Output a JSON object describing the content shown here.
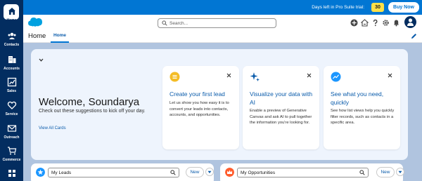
{
  "rail": {
    "items": [
      {
        "label": "Home",
        "icon": "home-icon"
      },
      {
        "label": "Contacts",
        "icon": "contacts-icon"
      },
      {
        "label": "Accounts",
        "icon": "accounts-icon"
      },
      {
        "label": "Sales",
        "icon": "sales-icon"
      },
      {
        "label": "Service",
        "icon": "service-icon"
      },
      {
        "label": "Outreach",
        "icon": "outreach-icon"
      },
      {
        "label": "Commerce",
        "icon": "commerce-icon"
      }
    ]
  },
  "banner": {
    "text": "Days left in Pro Suite trial:",
    "days": "30",
    "buy_label": "Buy Now",
    "color": "#0176d3"
  },
  "header": {
    "search_placeholder": "Search..."
  },
  "appnav": {
    "app_name": "Home",
    "tab_home": "Home"
  },
  "welcome": {
    "title": "Welcome, Soundarya",
    "subtitle": "Check out these suggestions to kick off your day.",
    "view_all": "View All Cards"
  },
  "cards": [
    {
      "title": "Create your first lead",
      "body": "Let us show you how easy it is to convert your leads into contacts, accounts, and opportunities.",
      "icon": "lead-icon",
      "icon_color": "#f4bc25"
    },
    {
      "title": "Visualize your data with AI",
      "body": "Enable a preview of Generative Canvas and ask AI to pull together the information you're looking for.",
      "icon": "ai-sparkle-icon",
      "icon_color": "#0b5cab"
    },
    {
      "title": "See what you need, quickly",
      "body": "See how list views help you quickly filter records, such as contacts in a specific area.",
      "icon": "trend-icon",
      "icon_color": "#1b96ff"
    }
  ],
  "bottom": {
    "leads": {
      "value": "My Leads",
      "new_label": "New",
      "icon_color": "#1b96ff"
    },
    "opportunities": {
      "value": "My Opportunities",
      "new_label": "New",
      "icon_color": "#ff5d2d"
    }
  }
}
